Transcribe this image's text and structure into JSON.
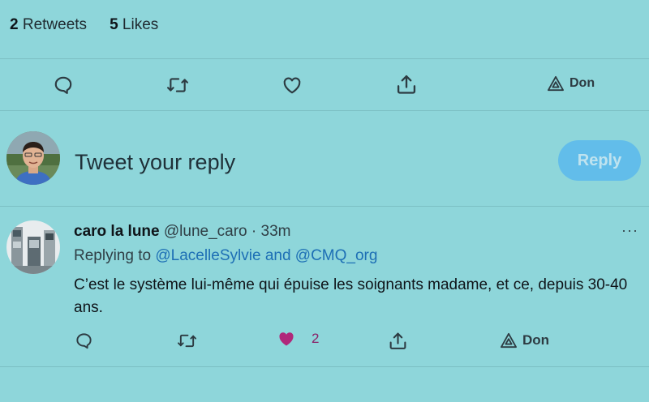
{
  "stats": {
    "retweets": {
      "count": "2",
      "label": "Retweets"
    },
    "likes": {
      "count": "5",
      "label": "Likes"
    }
  },
  "main_actions": {
    "reply_icon": "comment-icon",
    "retweet_icon": "retweet-icon",
    "like_icon": "heart-icon",
    "share_icon": "share-icon",
    "don_label": "Don",
    "don_icon": "triangle-icon"
  },
  "composer": {
    "placeholder": "Tweet your reply",
    "button_label": "Reply"
  },
  "reply_tweet": {
    "author": "caro la lune",
    "handle": "@lune_caro",
    "separator": "·",
    "time": "33m",
    "replying_prefix": "Replying to",
    "replying_user1": "@LacelleSylvie",
    "replying_and": "and",
    "replying_user2": "@CMQ_org",
    "text": "C’est le système lui-même qui épuise les soignants madame, et ce, depuis 30-40 ans.",
    "more_label": "···",
    "like_count": "2",
    "don_label": "Don",
    "liked_color": "#b0287a"
  },
  "colors": {
    "background": "#8ed6da",
    "accent": "#62bdea",
    "link": "#1d6fb5"
  }
}
